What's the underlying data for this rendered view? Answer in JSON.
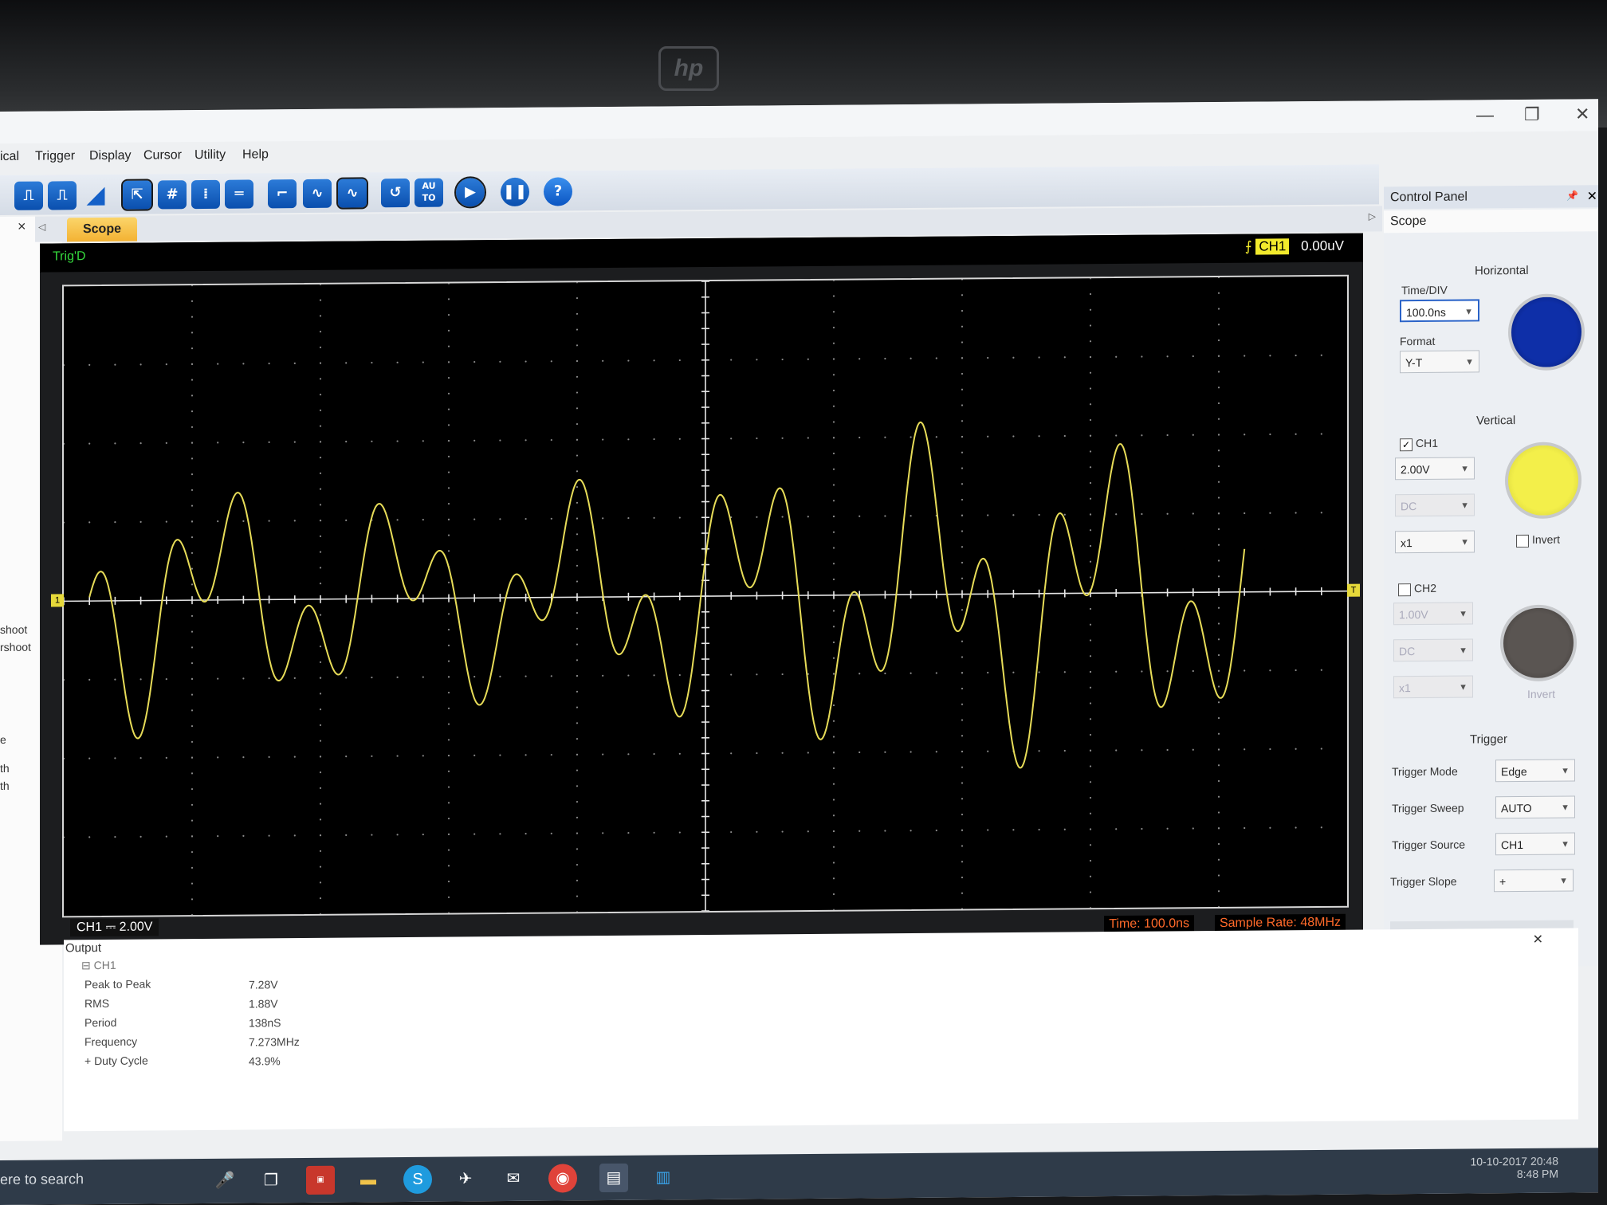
{
  "menu": [
    "ical",
    "Trigger",
    "Display",
    "Cursor",
    "Utility",
    "Help"
  ],
  "window": {
    "minimize": "—",
    "restore": "❐",
    "close": "✕"
  },
  "toolbar": {
    "autoset_label": "AU\nTO",
    "help_label": "?"
  },
  "left_pane": {
    "close": "×",
    "items": [
      "shoot",
      "rshoot",
      "e",
      "th",
      "th"
    ]
  },
  "scope": {
    "tab_label": "Scope",
    "trig_state": "Trig'D",
    "trig_channel": "CH1",
    "trig_level": "0.00uV",
    "ch1_scale": "CH1 ⎓  2.00V",
    "time_div": "Time: 100.0ns",
    "sample_rate": "Sample Rate: 48MHz",
    "ch_marker": "1",
    "trig_marker": "T"
  },
  "control_panel": {
    "title": "Control Panel",
    "subtitle": "Scope",
    "horizontal": {
      "section": "Horizontal",
      "time_div_label": "Time/DIV",
      "time_div": "100.0ns",
      "format_label": "Format",
      "format": "Y-T"
    },
    "vertical": {
      "section": "Vertical",
      "ch1": {
        "label": "CH1",
        "checked": true,
        "volts": "2.00V",
        "coupling": "DC",
        "probe": "x1",
        "invert_label": "Invert"
      },
      "ch2": {
        "label": "CH2",
        "checked": false,
        "volts": "1.00V",
        "coupling": "DC",
        "probe": "x1",
        "invert_label": "Invert"
      }
    },
    "trigger": {
      "section": "Trigger",
      "mode_label": "Trigger Mode",
      "mode": "Edge",
      "sweep_label": "Trigger Sweep",
      "sweep": "AUTO",
      "source_label": "Trigger Source",
      "source": "CH1",
      "slope_label": "Trigger Slope",
      "slope": "+"
    },
    "colors": {
      "ch1_knob": "#f3ef4a",
      "time_knob": "#0e2fa8",
      "ch2_knob": "#5a5552"
    }
  },
  "output": {
    "title": "Output",
    "channel": "CH1",
    "measurements": [
      {
        "label": "Peak to Peak",
        "value": "7.28V"
      },
      {
        "label": "RMS",
        "value": "1.88V"
      },
      {
        "label": "Period",
        "value": "138nS"
      },
      {
        "label": "Frequency",
        "value": "7.273MHz"
      },
      {
        "label": "+ Duty Cycle",
        "value": "43.9%"
      }
    ]
  },
  "taskbar": {
    "search_text": "ere to search",
    "date": "10-10-2017  20:48",
    "time": "8:48 PM"
  },
  "waveform": {
    "channel": "CH1",
    "color": "#e7dc58",
    "volts_per_div": 2.0,
    "time_per_div_ns": 100,
    "frequency_mhz": 7.273,
    "peak_to_peak_v": 7.28
  }
}
